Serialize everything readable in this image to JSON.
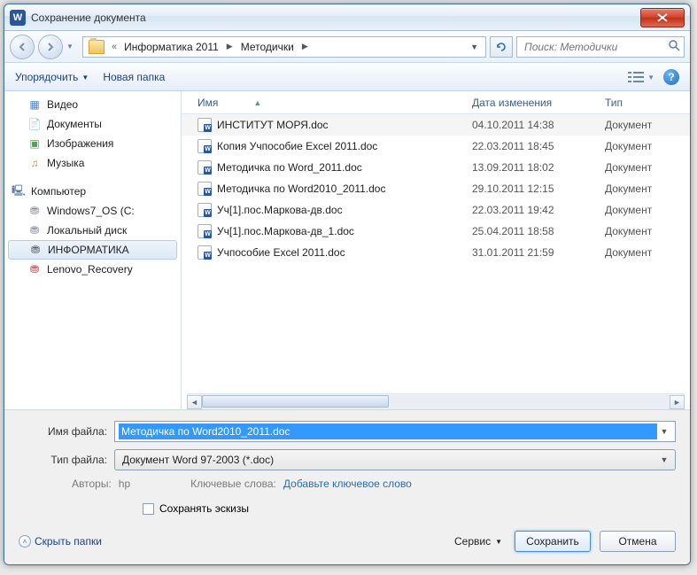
{
  "title": "Сохранение документа",
  "breadcrumb": {
    "chevrons": "«",
    "part1": "Информатика 2011",
    "part2": "Методички"
  },
  "search": {
    "placeholder": "Поиск: Методички"
  },
  "toolbar": {
    "organize": "Упорядочить",
    "new_folder": "Новая папка"
  },
  "sidebar": {
    "video": "Видео",
    "documents": "Документы",
    "images": "Изображения",
    "music": "Музыка",
    "computer": "Компьютер",
    "drive1": "Windows7_OS (C:",
    "drive2": "Локальный диск",
    "drive3": "ИНФОРМАТИКА",
    "drive4": "Lenovo_Recovery"
  },
  "columns": {
    "name": "Имя",
    "date": "Дата изменения",
    "type": "Тип"
  },
  "files": [
    {
      "name": "ИНСТИТУТ МОРЯ.doc",
      "date": "04.10.2011 14:38",
      "type": "Документ"
    },
    {
      "name": "Копия Учпособие Excel 2011.doc",
      "date": "22.03.2011 18:45",
      "type": "Документ"
    },
    {
      "name": "Методичка по Word_2011.doc",
      "date": "13.09.2011 18:02",
      "type": "Документ"
    },
    {
      "name": "Методичка по Word2010_2011.doc",
      "date": "29.10.2011 12:15",
      "type": "Документ"
    },
    {
      "name": "Уч[1].пос.Маркова-дв.doc",
      "date": "22.03.2011 19:42",
      "type": "Документ"
    },
    {
      "name": "Уч[1].пос.Маркова-дв_1.doc",
      "date": "25.04.2011 18:58",
      "type": "Документ"
    },
    {
      "name": "Учпособие Excel 2011.doc",
      "date": "31.01.2011 21:59",
      "type": "Документ"
    }
  ],
  "form": {
    "filename_label": "Имя файла:",
    "filename_value": "Методичка по Word2010_2011.doc",
    "filetype_label": "Тип файла:",
    "filetype_value": "Документ Word 97-2003 (*.doc)",
    "authors_label": "Авторы:",
    "authors_value": "hp",
    "keywords_label": "Ключевые слова:",
    "keywords_value": "Добавьте ключевое слово",
    "thumbnails": "Сохранять эскизы"
  },
  "buttons": {
    "hide_folders": "Скрыть папки",
    "tools": "Сервис",
    "save": "Сохранить",
    "cancel": "Отмена"
  },
  "glyphs": {
    "help": "?"
  }
}
